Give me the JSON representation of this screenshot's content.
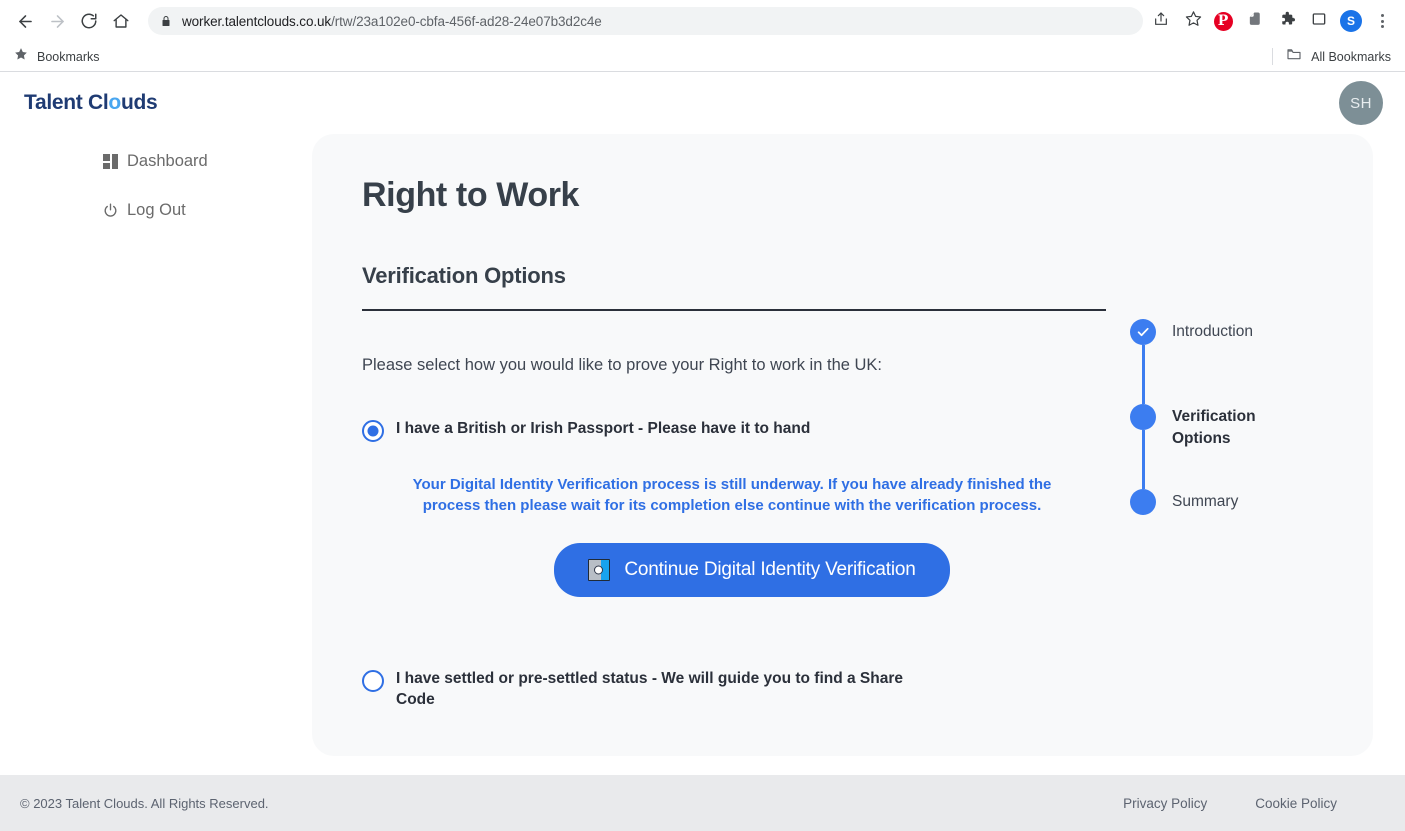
{
  "browser": {
    "back_icon": "back-arrow-icon",
    "forward_icon": "forward-arrow-icon",
    "reload_icon": "reload-icon",
    "home_icon": "home-icon",
    "lock_icon": "lock-icon",
    "url_host": "worker.talentclouds.co.uk",
    "url_path": "/rtw/23a102e0-cbfa-456f-ad28-24e07b3d2c4e",
    "share_icon": "share-icon",
    "bookmark_star_icon": "star-outline-icon",
    "extensions": [
      {
        "name": "pinterest-extension-icon",
        "glyph": "P"
      },
      {
        "name": "evernote-extension-icon",
        "glyph": ""
      },
      {
        "name": "extensions-puzzle-icon",
        "glyph": ""
      },
      {
        "name": "side-panel-icon",
        "glyph": ""
      }
    ],
    "profile_initial": "S",
    "menu_icon": "three-dot-menu-icon",
    "bookmarks_label": "Bookmarks",
    "all_bookmarks_label": "All Bookmarks",
    "folder_icon": "folder-icon"
  },
  "header": {
    "brand_prefix": "Talent Cl",
    "brand_accent": "o",
    "brand_suffix": "uds",
    "avatar_initials": "SH"
  },
  "sidebar": {
    "items": [
      {
        "label": "Dashboard",
        "icon": "grid-icon"
      },
      {
        "label": "Log Out",
        "icon": "power-icon"
      }
    ]
  },
  "main": {
    "page_title": "Right to Work",
    "section_title": "Verification Options",
    "prompt": "Please select how you would like to prove your Right to work in the UK:",
    "options": [
      {
        "label": "I have a British or Irish Passport - Please have it to hand",
        "selected": true
      },
      {
        "label": "I have settled or pre-settled status - We will guide you to find a Share Code",
        "selected": false
      }
    ],
    "notice": "Your Digital Identity Verification process is still underway. If you have already finished the process then please wait for its completion else continue with the verification process.",
    "continue_button": "Continue Digital Identity Verification",
    "continue_button_icon": "identity-card-icon"
  },
  "stepper": {
    "steps": [
      {
        "label": "Introduction",
        "state": "completed"
      },
      {
        "label": "Verification Options",
        "state": "current"
      },
      {
        "label": "Summary",
        "state": "upcoming"
      }
    ]
  },
  "footer": {
    "copyright": "© 2023 Talent Clouds. All Rights Reserved.",
    "links": [
      {
        "label": "Privacy Policy"
      },
      {
        "label": "Cookie Policy"
      }
    ]
  },
  "colors": {
    "accent_blue": "#2f6fe4",
    "step_blue": "#3c7df0",
    "brand_navy": "#1f3b73",
    "brand_light": "#49a6f0",
    "heading": "#37404a",
    "card_bg": "#f8f9fa",
    "footer_bg": "#e9eaec"
  }
}
